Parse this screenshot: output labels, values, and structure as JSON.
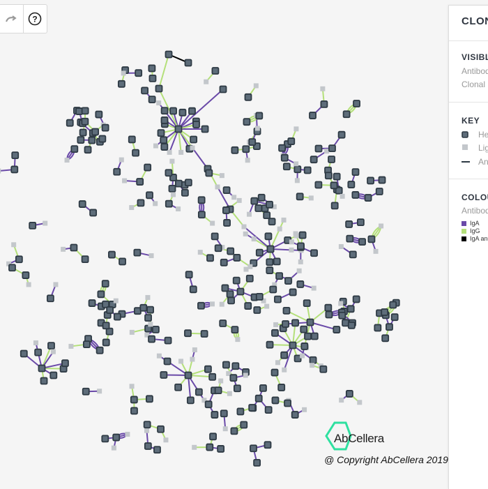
{
  "toolbar": {
    "redo_icon": "redo-icon",
    "help_icon": "help-icon",
    "help_glyph": "?"
  },
  "panel": {
    "title": "CLON",
    "visible_heading": "VISIBL",
    "visible_items": [
      "Antibod",
      "Clonal"
    ],
    "key_heading": "KEY",
    "key_items": [
      "He",
      "Lig",
      "An"
    ],
    "colour_heading": "COLOU",
    "colour_subtitle": "Antibod",
    "legend": [
      {
        "label": "IgA",
        "color": "#6a4aa8"
      },
      {
        "label": "IgG",
        "color": "#b4e07a"
      },
      {
        "label": "IgA and",
        "color": "#000000"
      }
    ]
  },
  "branding": {
    "logo_text": "AbCellera",
    "copyright": "@ Copyright AbCellera 2019",
    "logo_color": "#2fe0a0"
  },
  "graph_colors": {
    "heavy_fill": "#5e6d7a",
    "heavy_stroke": "#2e3a44",
    "light_fill": "#c3c7cb",
    "iga": "#6a4aa8",
    "igg": "#b4e07a",
    "both": "#000000"
  }
}
